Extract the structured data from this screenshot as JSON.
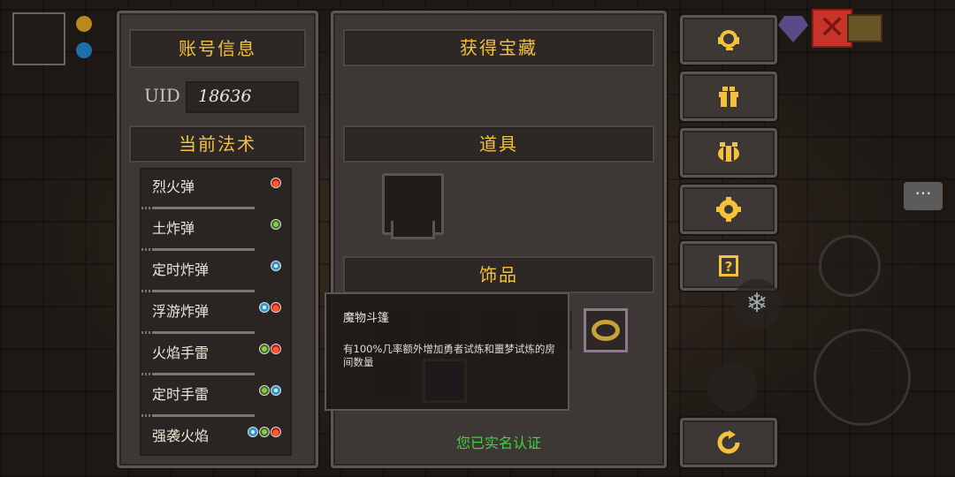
{
  "account": {
    "title": "账号信息",
    "uid_label": "UID",
    "uid_value": "18636"
  },
  "spells": {
    "title": "当前法术",
    "items": [
      {
        "name": "烈火弹",
        "icons": [
          "fire"
        ]
      },
      {
        "name": "土炸弹",
        "icons": [
          "earth"
        ]
      },
      {
        "name": "定时炸弹",
        "icons": [
          "ice"
        ]
      },
      {
        "name": "浮游炸弹",
        "icons": [
          "ice",
          "fire"
        ]
      },
      {
        "name": "火焰手雷",
        "icons": [
          "earth",
          "fire"
        ]
      },
      {
        "name": "定时手雷",
        "icons": [
          "earth",
          "ice"
        ]
      },
      {
        "name": "强袭火焰",
        "icons": [
          "ice",
          "earth",
          "fire"
        ]
      }
    ]
  },
  "treasure": {
    "title": "获得宝藏",
    "items_title": "道具",
    "accessories_title": "饰品",
    "verified_text": "您已实名认证"
  },
  "tooltip": {
    "name": "魔物斗篷",
    "description": "有100%几率额外增加勇者试炼和噩梦试炼的房间数量"
  },
  "side_buttons": [
    {
      "icon": "customer-service-icon"
    },
    {
      "icon": "gift-icon"
    },
    {
      "icon": "bee-icon"
    },
    {
      "icon": "settings-gear-icon"
    },
    {
      "icon": "help-book-icon"
    }
  ],
  "colors": {
    "gold": "#f3c13e",
    "verified_green": "#3fd33a",
    "panel": "#3d3835"
  }
}
